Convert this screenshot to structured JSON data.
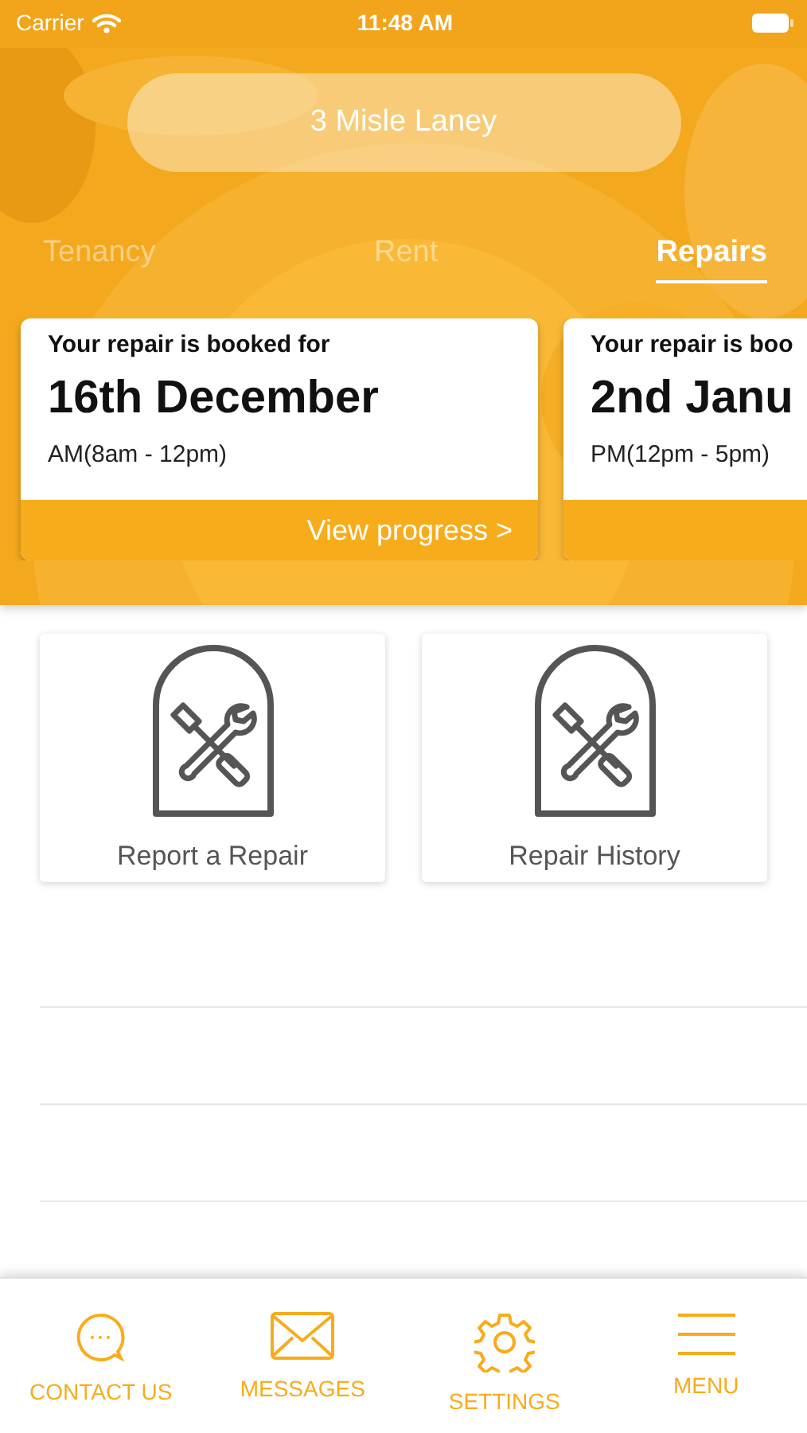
{
  "status_bar": {
    "carrier": "Carrier",
    "time": "11:48 AM"
  },
  "header": {
    "property": "3 Misle Laney"
  },
  "tabs": [
    {
      "label": "Tenancy",
      "selected": false
    },
    {
      "label": "Rent",
      "selected": false
    },
    {
      "label": "Repairs",
      "selected": true
    }
  ],
  "bookings": [
    {
      "intro": "Your repair is booked for",
      "date": "16th December",
      "slot": "AM(8am - 12pm)",
      "action": "View progress >"
    },
    {
      "intro": "Your repair is boo",
      "date": "2nd Janu",
      "slot": "PM(12pm - 5pm)"
    }
  ],
  "tiles": [
    {
      "label": "Report a Repair"
    },
    {
      "label": "Repair History"
    }
  ],
  "tab_bar": [
    {
      "kind": "chat",
      "label": "CONTACT US"
    },
    {
      "kind": "mail",
      "label": "MESSAGES"
    },
    {
      "kind": "gear",
      "label": "SETTINGS"
    },
    {
      "kind": "menu",
      "label": "MENU"
    }
  ]
}
